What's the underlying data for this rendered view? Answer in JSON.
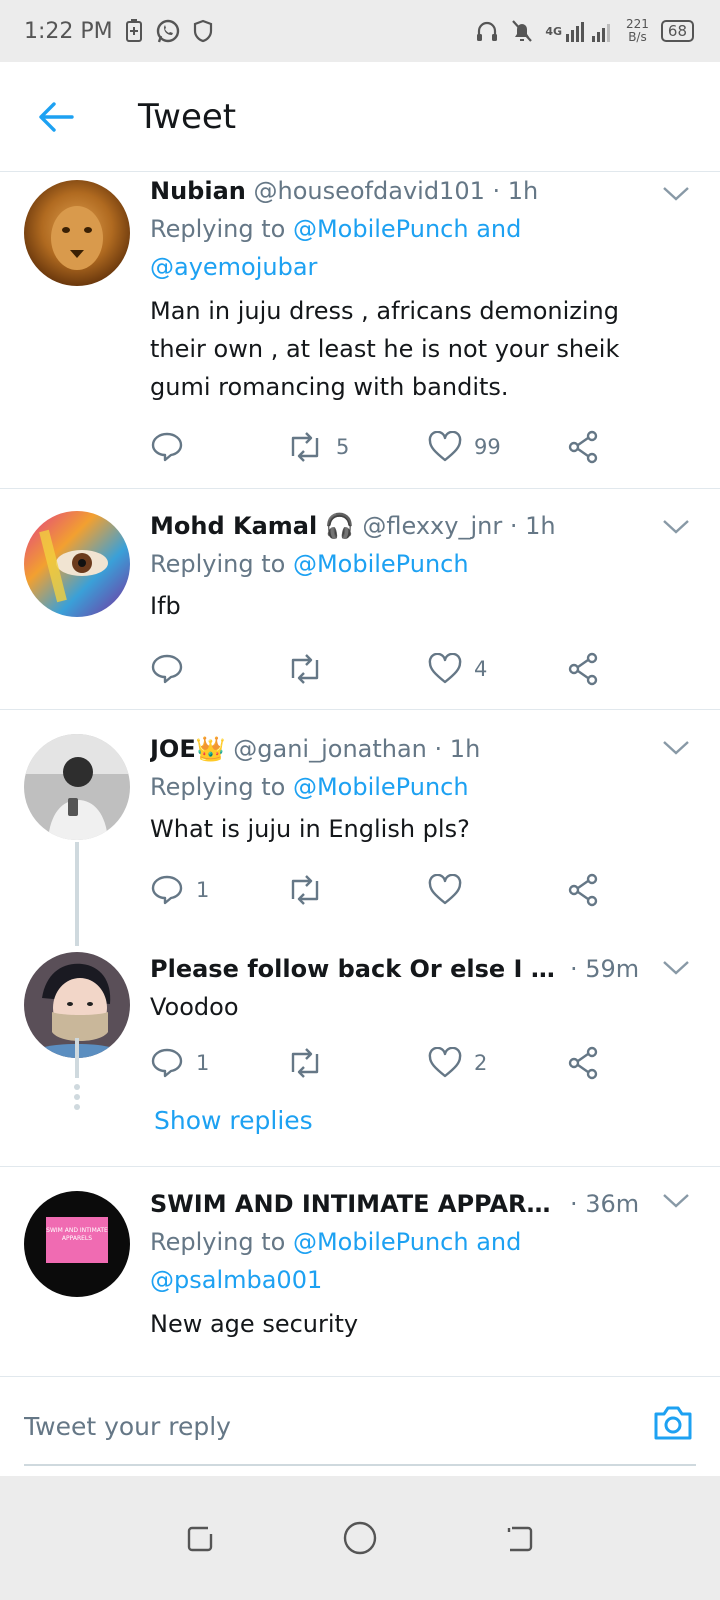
{
  "status_bar": {
    "time": "1:22 PM",
    "network": "4G",
    "speed_value": "221",
    "speed_unit": "B/s",
    "battery": "68",
    "icons_left": [
      "battery-saver-icon",
      "whatsapp-icon",
      "shield-icon"
    ],
    "icons_right": [
      "headphones-icon",
      "mute-icon",
      "signal-icon"
    ]
  },
  "header": {
    "title": "Tweet",
    "back_icon": "arrow-left-icon"
  },
  "tweets": [
    {
      "name": "Nubian",
      "handle": "@houseofdavid101",
      "time": "· 1h",
      "replying_prefix": "Replying to",
      "replying_line1": "@MobilePunch and",
      "replying_line2": "@ayemojubar",
      "text_lines": [
        "Man in juju dress , africans demonizing",
        "their own , at least he is not your sheik",
        "gumi romancing with bandits."
      ],
      "replies": "",
      "retweets": "5",
      "likes": "99"
    },
    {
      "name": "Mohd Kamal",
      "name_emoji": "🎧",
      "handle": "@flexxy_jnr",
      "time": "· 1h",
      "replying_prefix": "Replying to",
      "replying_line1": "@MobilePunch",
      "text_lines": [
        "Ifb"
      ],
      "replies": "",
      "retweets": "",
      "likes": "4"
    },
    {
      "name": "JOE",
      "name_emoji": "👑",
      "handle": "@gani_jonathan",
      "time": "· 1h",
      "replying_prefix": "Replying to",
      "replying_line1": "@MobilePunch",
      "text_lines": [
        "What is juju in English pls?"
      ],
      "replies": "1",
      "retweets": "",
      "likes": ""
    },
    {
      "name": "Please follow back Or else I go u...",
      "time": "· 59m",
      "text_lines": [
        "Voodoo"
      ],
      "replies": "1",
      "retweets": "",
      "likes": "2",
      "show_replies": "Show replies"
    },
    {
      "name": "SWIM AND INTIMATE APPARE...",
      "time": "· 36m",
      "replying_prefix": "Replying to",
      "replying_line1": "@MobilePunch and",
      "replying_line2": "@psalmba001",
      "text_lines": [
        "New age security"
      ],
      "avatar_text": "SWIM AND INTIMATE APPARELS"
    }
  ],
  "composer": {
    "placeholder": "Tweet your reply",
    "camera_icon": "camera-icon"
  },
  "colors": {
    "accent": "#1da1f2",
    "secondary_text": "#657786",
    "divider": "#e1e8ed"
  }
}
